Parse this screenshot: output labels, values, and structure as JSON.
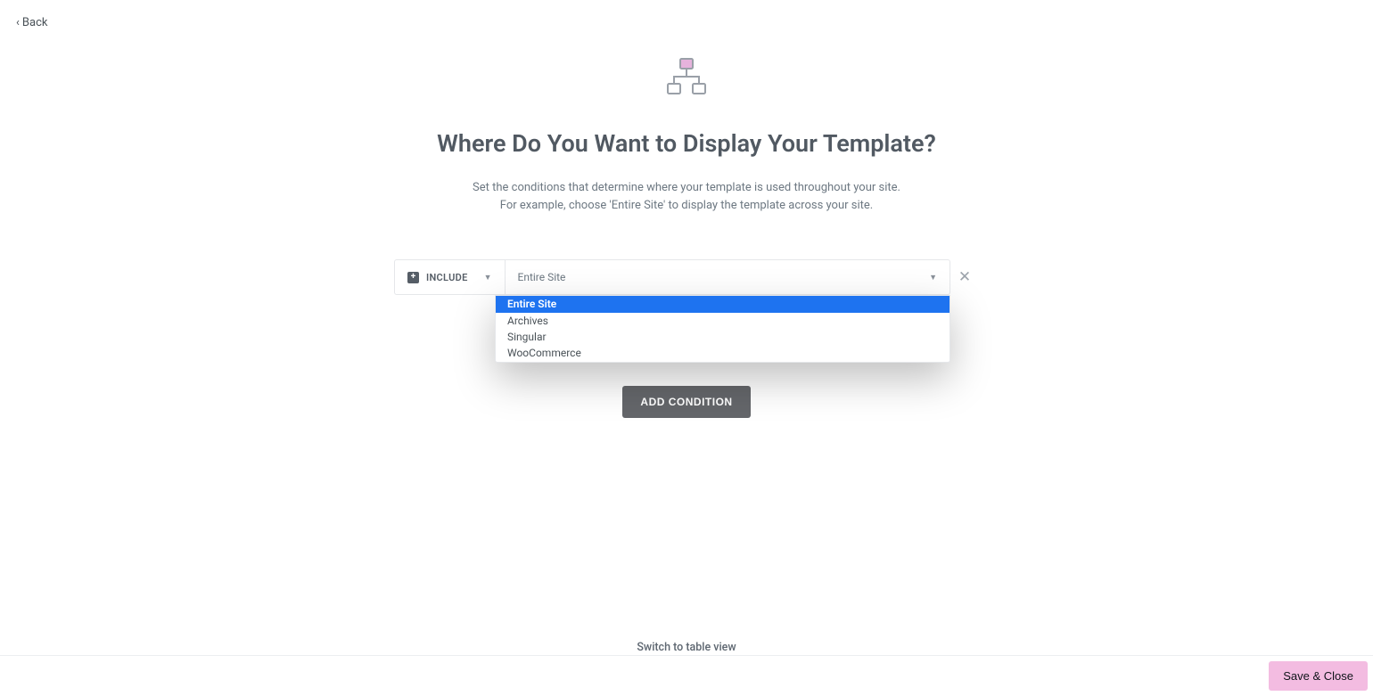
{
  "nav": {
    "back_label": "Back"
  },
  "header": {
    "title": "Where Do You Want to Display Your Template?",
    "description_line1": "Set the conditions that determine where your template is used throughout your site.",
    "description_line2": "For example, choose 'Entire Site' to display the template across your site."
  },
  "condition": {
    "mode_label": "INCLUDE",
    "selected_value": "Entire Site",
    "options": [
      "Entire Site",
      "Archives",
      "Singular",
      "WooCommerce"
    ]
  },
  "actions": {
    "add_condition": "ADD CONDITION",
    "switch_view": "Switch to table view",
    "save_close": "Save & Close"
  }
}
